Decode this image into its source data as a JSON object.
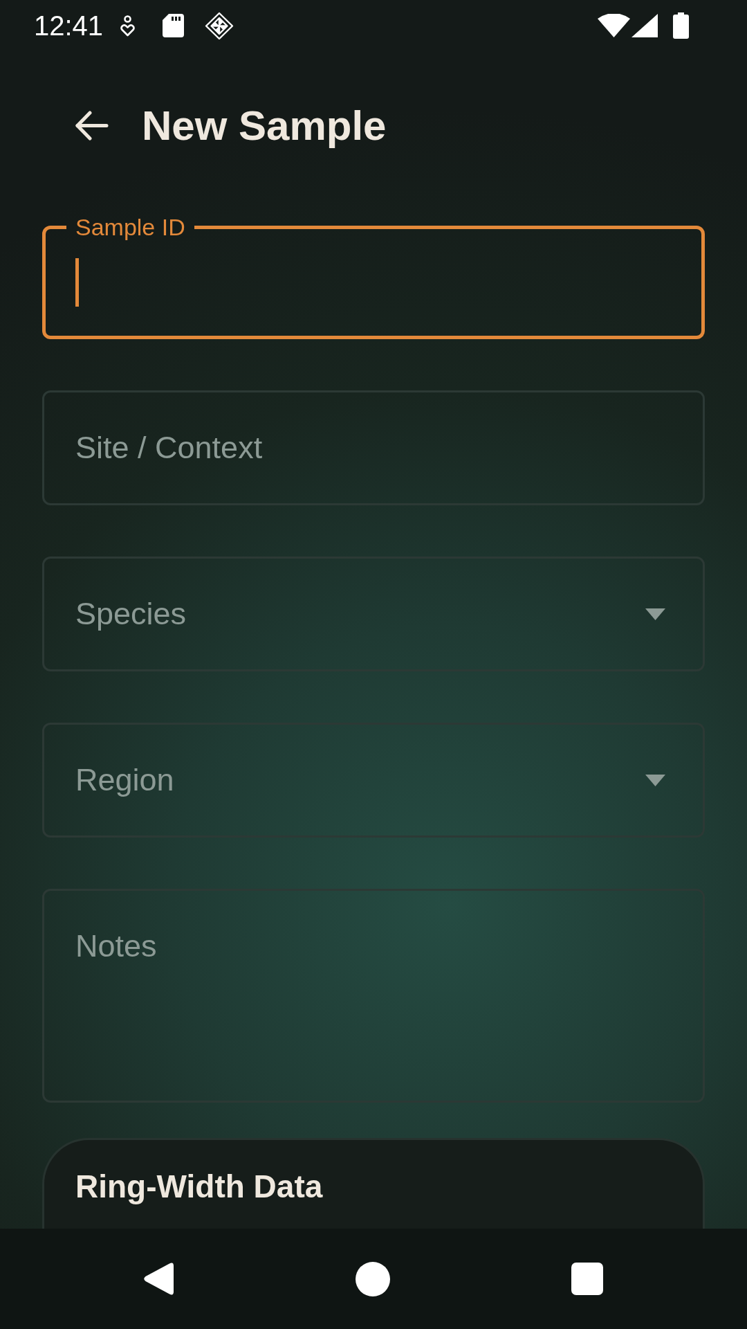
{
  "status_bar": {
    "time": "12:41"
  },
  "app_bar": {
    "title": "New Sample"
  },
  "form": {
    "fields": [
      {
        "kind": "text",
        "label": "Sample ID",
        "focused": true
      },
      {
        "kind": "text",
        "label": "Site / Context",
        "focused": false
      },
      {
        "kind": "dropdown",
        "label": "Species",
        "focused": false
      },
      {
        "kind": "dropdown",
        "label": "Region",
        "focused": false
      },
      {
        "kind": "multiline",
        "label": "Notes",
        "focused": false
      }
    ]
  },
  "card": {
    "title": "Ring-Width Data"
  }
}
